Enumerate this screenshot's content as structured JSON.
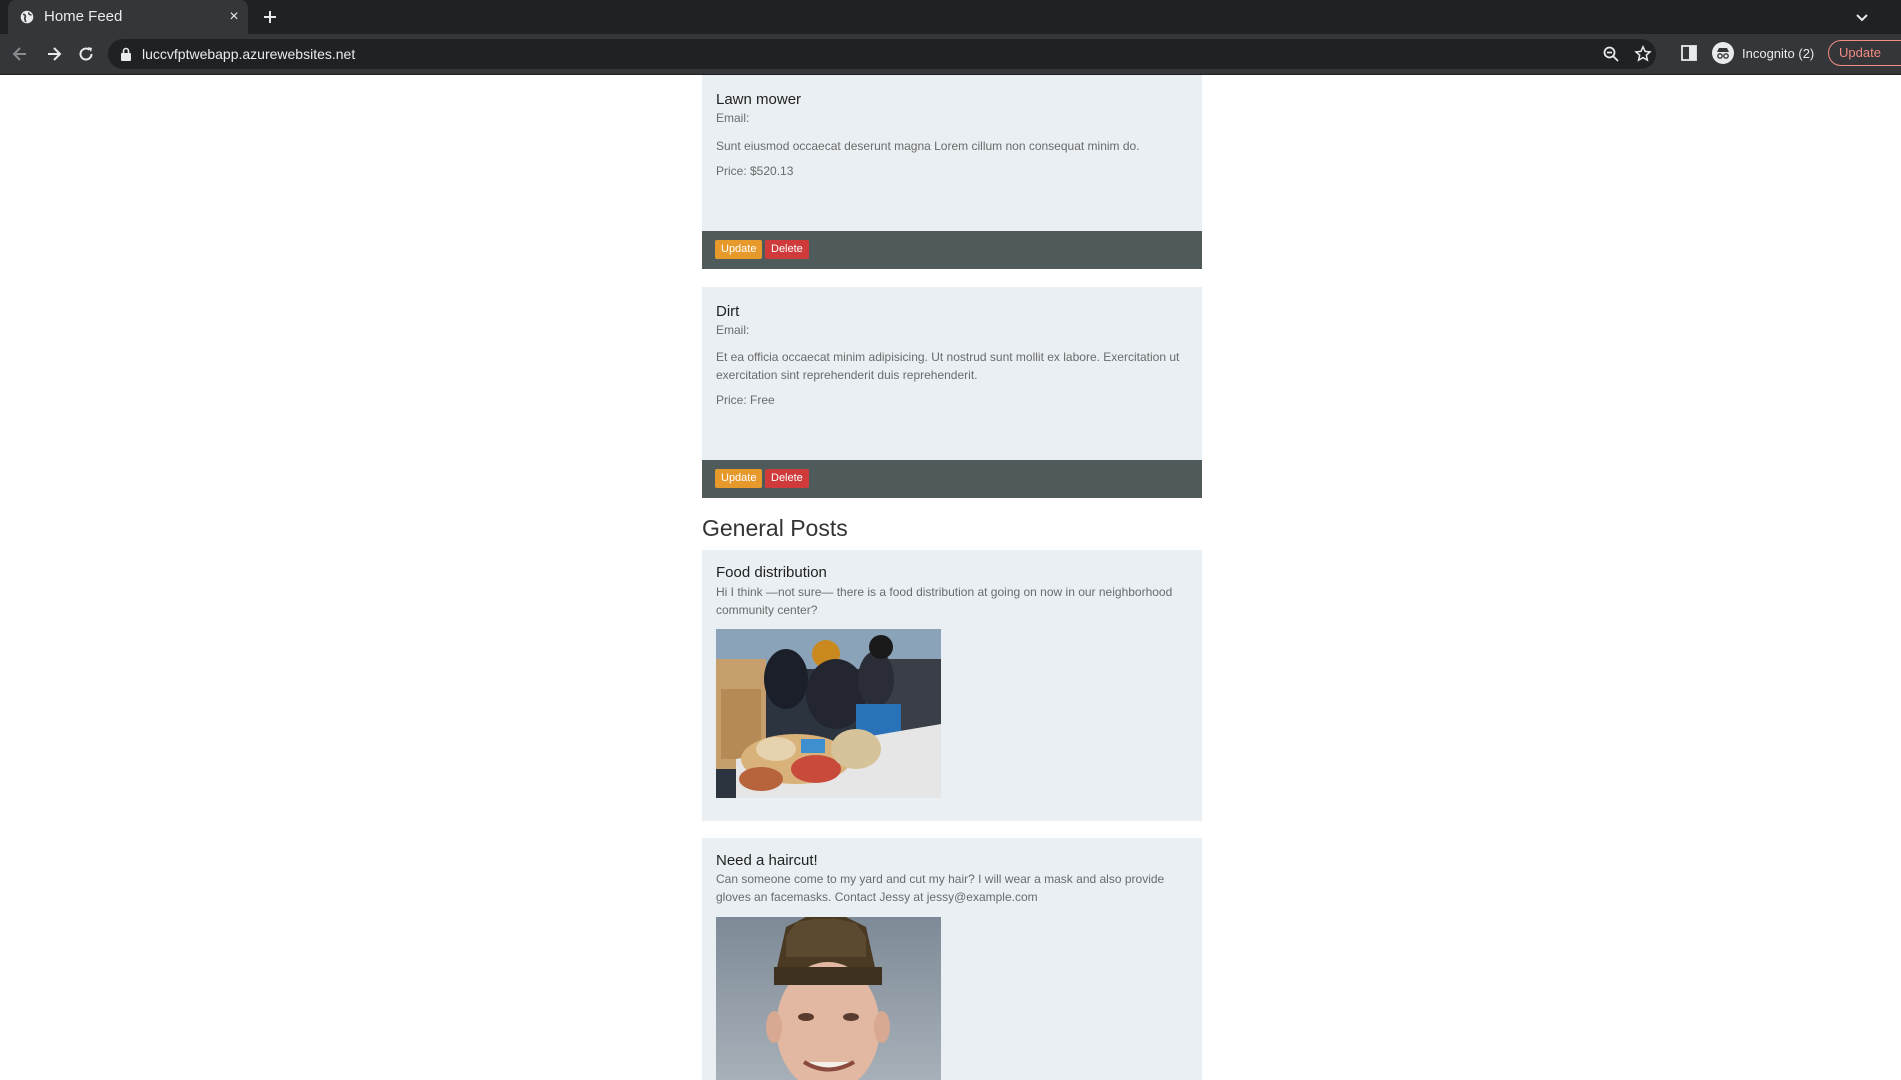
{
  "browser": {
    "tab_title": "Home Feed",
    "tab_close": "×",
    "url": "luccvfptwebapp.azurewebsites.net",
    "incognito_label": "Incognito (2)",
    "update_label": "Update",
    "colors": {
      "tabstrip": "#202124",
      "toolbar": "#35363a",
      "update_accent": "#f28b82"
    }
  },
  "listings": [
    {
      "title": "Lawn mower",
      "email_label": "Email:",
      "description": "Sunt eiusmod occaecat deserunt magna Lorem cillum non consequat minim do.",
      "price": "Price: $520.13",
      "update_label": "Update",
      "delete_label": "Delete"
    },
    {
      "title": "Dirt",
      "email_label": "Email:",
      "description": "Et ea officia occaecat minim adipisicing. Ut nostrud sunt mollit ex labore. Exercitation ut exercitation sint reprehenderit duis reprehenderit.",
      "price": "Price: Free",
      "update_label": "Update",
      "delete_label": "Delete"
    }
  ],
  "general_heading": "General Posts",
  "posts": [
    {
      "title": "Food distribution",
      "body": "Hi I think —not sure— there is a food distribution at going on now in our neighborhood community center?",
      "image": "food-distribution-photo"
    },
    {
      "title": "Need a haircut!",
      "body": "Can someone come to my yard and cut my hair? I will wear a mask and also provide gloves an facemasks. Contact Jessy at jessy@example.com",
      "image": "haircut-portrait-photo"
    }
  ],
  "colors": {
    "card_bg": "#e9eff3",
    "card_footer": "#4f5b5b",
    "update_button": "#e8992b",
    "delete_button": "#cf3b3b"
  }
}
